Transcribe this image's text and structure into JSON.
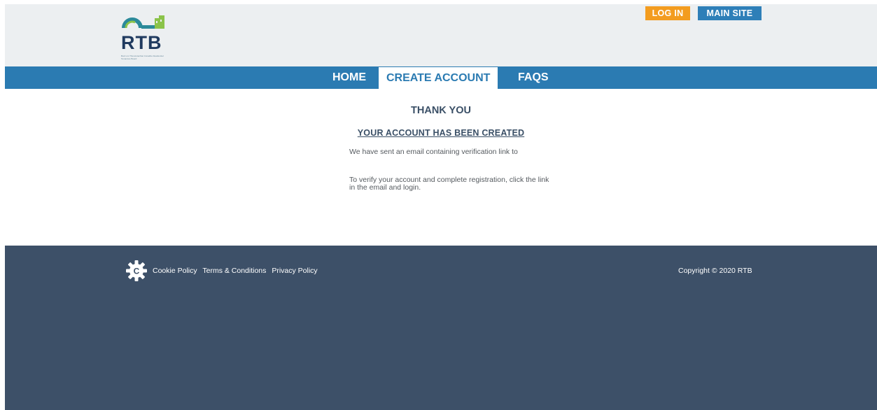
{
  "header": {
    "logo_text": "RTB",
    "logo_tagline": "Bord um Thionóntachtaí Cónaithe Residential Tenancies Board",
    "login_label": "LOG IN",
    "main_site_label": "MAIN SITE"
  },
  "nav": {
    "items": [
      {
        "label": "HOME"
      },
      {
        "label": "CREATE ACCOUNT"
      },
      {
        "label": "FAQS"
      }
    ]
  },
  "main": {
    "title": "THANK YOU",
    "subtitle": "YOUR ACCOUNT HAS BEEN CREATED",
    "message1": "We have sent an email containing verification link to",
    "message2": "To verify your account and complete registration, click the link in the email and login."
  },
  "footer": {
    "links": [
      {
        "label": "Cookie Policy"
      },
      {
        "label": "Terms & Conditions"
      },
      {
        "label": "Privacy Policy"
      }
    ],
    "copyright": "Copyright © 2020 RTB"
  },
  "colors": {
    "header_bg": "#eceff1",
    "nav_bg": "#2b7bb2",
    "login_button": "#f39c1f",
    "main_site_button": "#2e7fb8",
    "heading_text": "#3a4f66",
    "footer_bg": "#3d5068"
  },
  "icons": {
    "cookie": "cookie-gear-icon"
  }
}
